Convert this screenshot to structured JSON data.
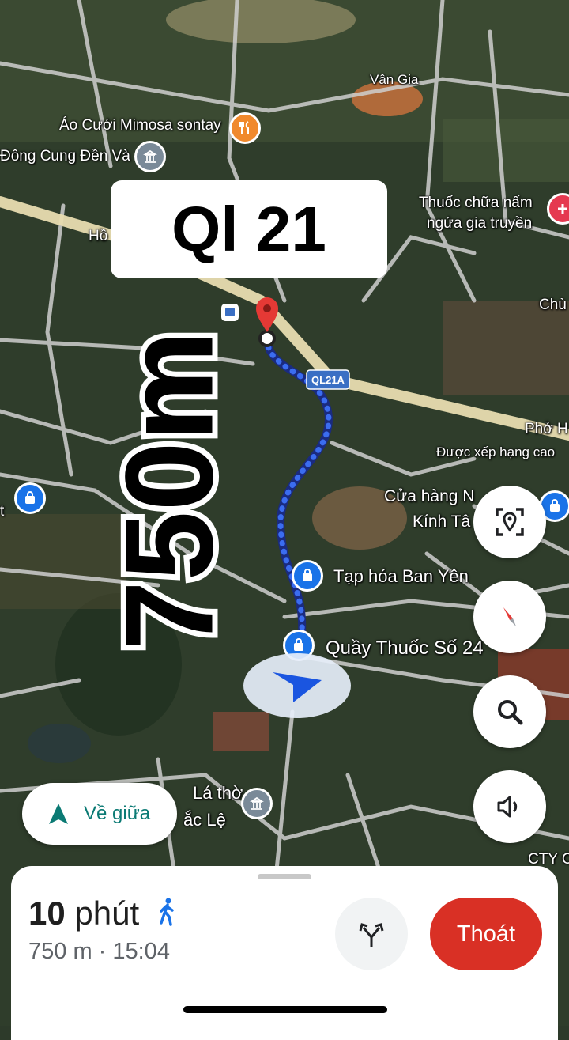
{
  "map": {
    "labels": {
      "van_gia": "Vân Gia",
      "ao_cuoi": "Áo Cưới Mimosa sontay",
      "dong_cung": "Đông Cung Đền Và",
      "thuoc_chua": "Thuốc chữa nấm",
      "ngua_gia": "ngứa gia truyền",
      "ho": "Hồ",
      "chu": "Chù",
      "pho": "Phở H",
      "duoc_xep": "Được xếp hạng cao",
      "cua_hang": "Cửa hàng N",
      "kinh_ta": "Kính Tâ",
      "tap_hoa": "Tạp hóa Ban Yên",
      "quay_thuoc": "Quầy Thuốc Số 24",
      "la_tho": "Lá thờ",
      "lac_le": "ắc Lệ",
      "cty": "CTY C",
      "road_badge": "QL21A",
      "left_t": "t"
    },
    "route_color": "#3b6df0",
    "pin_color": "#e53935"
  },
  "overlay": {
    "headline": "Ql 21",
    "distance_vertical": "750m"
  },
  "controls": {
    "recenter_label": "Về giữa",
    "icons": [
      "location-scan-icon",
      "compass-icon",
      "search-icon",
      "volume-icon"
    ]
  },
  "bottom": {
    "eta_number": "10",
    "eta_unit": "phút",
    "eta_sub": "750 m · 15:04",
    "exit_label": "Thoát",
    "mode_icon": "walking-icon",
    "alt_icon": "route-options-icon",
    "accent": "#d93025"
  }
}
